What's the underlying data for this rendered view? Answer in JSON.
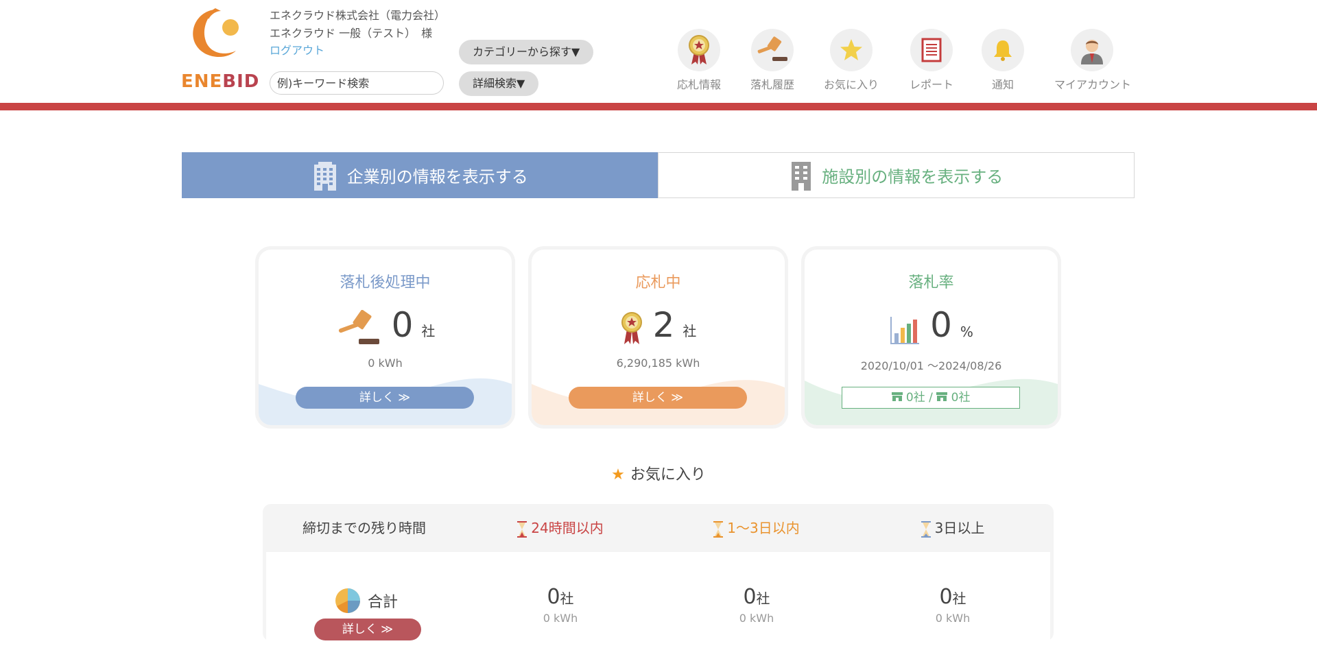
{
  "header": {
    "logo_text_a": "ENE",
    "logo_text_b": "BID",
    "company_line": "エネクラウド株式会社（電力会社）",
    "user_line": "エネクラウド 一般（テスト）　様",
    "logout": "ログアウト",
    "search_placeholder": "例)キーワード検索",
    "category_button": "カテゴリーから探す▼",
    "detail_search_button": "詳細検索▼",
    "nav": [
      {
        "label": "応札情報",
        "icon": "award-ribbon-icon"
      },
      {
        "label": "落札履歴",
        "icon": "gavel-icon"
      },
      {
        "label": "お気に入り",
        "icon": "star-icon"
      },
      {
        "label": "レポート",
        "icon": "report-document-icon"
      },
      {
        "label": "通知",
        "icon": "bell-icon"
      },
      {
        "label": "マイアカウント",
        "icon": "user-avatar-icon"
      }
    ]
  },
  "tabs": {
    "company": "企業別の情報を表示する",
    "facility": "施設別の情報を表示する"
  },
  "cards": {
    "post_award": {
      "title": "落札後処理中",
      "value": "0",
      "unit": "社",
      "sub": "0 kWh",
      "button": "詳しく ≫",
      "color": "#7b9ac9"
    },
    "bidding": {
      "title": "応札中",
      "value": "2",
      "unit": "社",
      "sub": "6,290,185 kWh",
      "button": "詳しく ≫",
      "color": "#ea9a5c"
    },
    "win_rate": {
      "title": "落札率",
      "value": "0",
      "unit": "%",
      "sub": "2020/10/01 〜2024/08/26",
      "outline_a": "0社 /",
      "outline_b": "0社",
      "color": "#67b07f"
    }
  },
  "favorites": {
    "heading": "お気に入り",
    "remaining_label": "締切までの残り時間",
    "col_24h": "24時間以内",
    "col_1_3d": "1〜3日以内",
    "col_3d_plus": "3日以上",
    "total_label": "合計",
    "total_button": "詳しく ≫",
    "rows": {
      "h24": {
        "count": "0",
        "unit": "社",
        "kwh": "0 kWh"
      },
      "d13": {
        "count": "0",
        "unit": "社",
        "kwh": "0 kWh"
      },
      "d3p": {
        "count": "0",
        "unit": "社",
        "kwh": "0 kWh"
      }
    }
  },
  "colors": {
    "accent_red": "#c94444",
    "blue": "#7b9ac9",
    "orange": "#ea9a5c",
    "green": "#67b07f",
    "link": "#5aa7d8"
  }
}
